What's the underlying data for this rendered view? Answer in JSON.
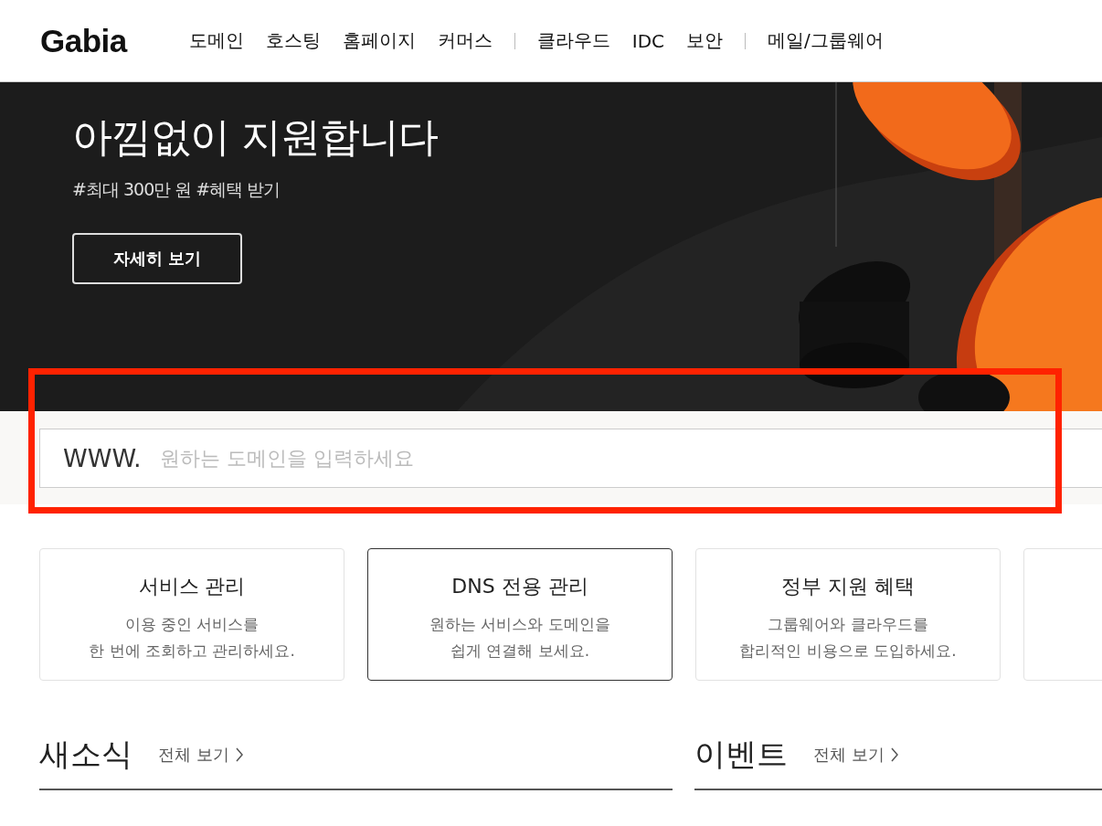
{
  "header": {
    "logo": "Gabia",
    "nav_groups": [
      [
        "도메인",
        "호스팅",
        "홈페이지",
        "커머스"
      ],
      [
        "클라우드",
        "IDC",
        "보안"
      ],
      [
        "메일/그룹웨어"
      ]
    ]
  },
  "hero": {
    "title": "아낌없이 지원합니다",
    "tags": "#최대 300만 원 #혜택 받기",
    "button": "자세히 보기"
  },
  "search": {
    "prefix": "WWW.",
    "placeholder": "원하는 도메인을 입력하세요"
  },
  "cards": [
    {
      "title": "서비스 관리",
      "lines": [
        "이용 중인 서비스를",
        "한 번에 조회하고 관리하세요."
      ],
      "selected": false
    },
    {
      "title": "DNS 전용 관리",
      "lines": [
        "원하는 서비스와 도메인을",
        "쉽게 연결해 보세요."
      ],
      "selected": true
    },
    {
      "title": "정부 지원 혜택",
      "lines": [
        "그룹웨어와 클라우드를",
        "합리적인 비용으로 도입하세요."
      ],
      "selected": false
    }
  ],
  "sections": [
    {
      "title": "새소식",
      "more": "전체 보기"
    },
    {
      "title": "이벤트",
      "more": "전체 보기"
    }
  ]
}
